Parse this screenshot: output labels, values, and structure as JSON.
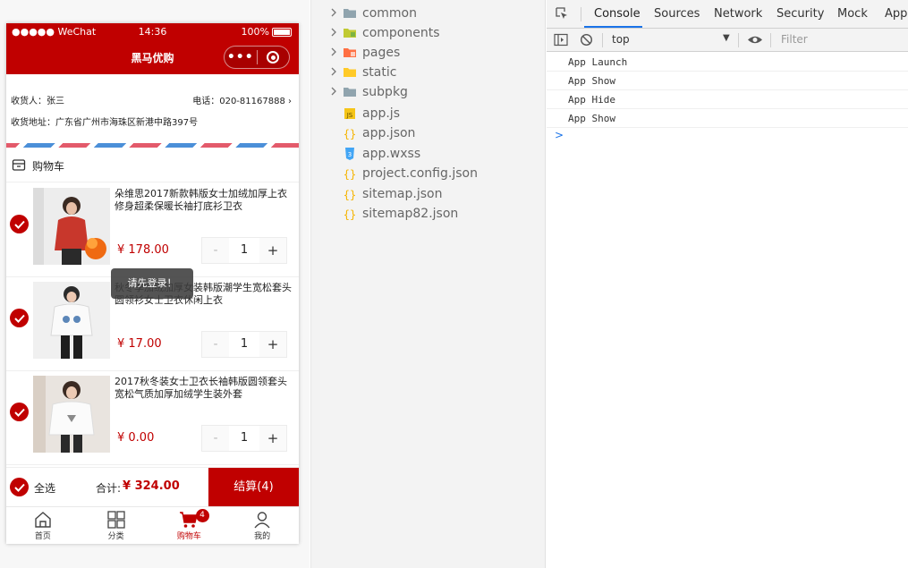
{
  "phone": {
    "status": {
      "carrier": "●●●●● WeChat",
      "time": "14:36",
      "battery": "100%"
    },
    "nav_title": "黑马优购",
    "capsule": {
      "menu_icon": "more-dots-icon",
      "close_icon": "target-icon"
    },
    "address": {
      "receiver": "收货人：张三",
      "phone": "电话：020-81167888",
      "detail": "收货地址：广东省广州市海珠区新港中路397号"
    },
    "cart_title": "购物车",
    "items": [
      {
        "name": "朵维思2017新款韩版女士加绒加厚上衣修身超柔保暖长袖打底衫卫衣",
        "price": "¥ 178.00",
        "qty": "1"
      },
      {
        "name": "秋冬季加绒加厚女装韩版潮学生宽松套头圆领衫女士卫衣休闲上衣",
        "price": "¥ 17.00",
        "qty": "1"
      },
      {
        "name": "2017秋冬装女士卫衣长袖韩版圆领套头宽松气质加厚加绒学生装外套",
        "price": "¥ 0.00",
        "qty": "1"
      }
    ],
    "stepper": {
      "minus": "-",
      "plus": "+"
    },
    "toast": "请先登录！",
    "settle": {
      "select_all": "全选",
      "total_label": "合计:",
      "total_value": "¥ 324.00",
      "button": "结算(4)"
    },
    "tabbar": [
      {
        "label": "首页",
        "icon": "home-icon"
      },
      {
        "label": "分类",
        "icon": "category-icon"
      },
      {
        "label": "购物车",
        "icon": "cart-icon",
        "badge": "4",
        "active": true
      },
      {
        "label": "我的",
        "icon": "user-icon"
      }
    ],
    "colors": {
      "brand": "#c00000"
    }
  },
  "file_tree": [
    {
      "name": "common",
      "type": "folder"
    },
    {
      "name": "components",
      "type": "folder"
    },
    {
      "name": "pages",
      "type": "folder"
    },
    {
      "name": "static",
      "type": "folder"
    },
    {
      "name": "subpkg",
      "type": "folder"
    },
    {
      "name": "app.js",
      "type": "js"
    },
    {
      "name": "app.json",
      "type": "json"
    },
    {
      "name": "app.wxss",
      "type": "wxss"
    },
    {
      "name": "project.config.json",
      "type": "json"
    },
    {
      "name": "sitemap.json",
      "type": "json"
    },
    {
      "name": "sitemap82.json",
      "type": "json"
    }
  ],
  "devtools": {
    "tabs": [
      "Console",
      "Sources",
      "Network",
      "Security",
      "Mock",
      "AppD"
    ],
    "active_tab": "Console",
    "context": "top",
    "filter_placeholder": "Filter",
    "logs": [
      "App Launch",
      "App Show",
      "App Hide",
      "App Show"
    ],
    "prompt": ">"
  }
}
